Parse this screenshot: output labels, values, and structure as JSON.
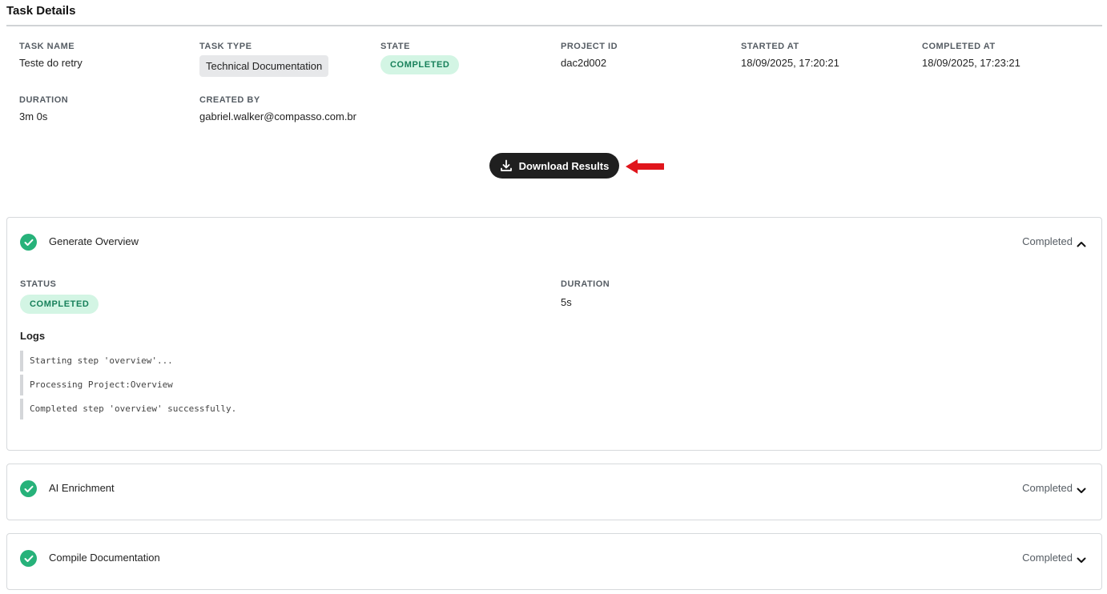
{
  "page": {
    "title": "Task Details"
  },
  "summary": {
    "task_name": {
      "label": "TASK NAME",
      "value": "Teste do retry"
    },
    "task_type": {
      "label": "TASK TYPE",
      "value": "Technical Documentation"
    },
    "state": {
      "label": "STATE",
      "value": "COMPLETED"
    },
    "project_id": {
      "label": "PROJECT ID",
      "value": "dac2d002"
    },
    "started_at": {
      "label": "STARTED AT",
      "value": "18/09/2025, 17:20:21"
    },
    "completed_at": {
      "label": "COMPLETED AT",
      "value": "18/09/2025, 17:23:21"
    },
    "duration": {
      "label": "DURATION",
      "value": "3m 0s"
    },
    "created_by": {
      "label": "CREATED BY",
      "value": "gabriel.walker@compasso.com.br"
    }
  },
  "actions": {
    "download_label": "Download Results"
  },
  "colors": {
    "accent_green": "#27b27a",
    "badge_bg": "#d3f5e4",
    "badge_text": "#17805a",
    "button_dark": "#1f1f1f",
    "annotation_red": "#e0151c"
  },
  "steps": [
    {
      "title": "Generate Overview",
      "status": "Completed",
      "expanded": true,
      "icon": "check-circle-icon",
      "detail": {
        "status_label": "STATUS",
        "status_value": "COMPLETED",
        "duration_label": "DURATION",
        "duration_value": "5s",
        "logs_title": "Logs",
        "logs": [
          "Starting step 'overview'...",
          "Processing Project:Overview",
          "Completed step 'overview' successfully."
        ]
      }
    },
    {
      "title": "AI Enrichment",
      "status": "Completed",
      "expanded": false,
      "icon": "check-circle-icon"
    },
    {
      "title": "Compile Documentation",
      "status": "Completed",
      "expanded": false,
      "icon": "check-circle-icon"
    }
  ]
}
